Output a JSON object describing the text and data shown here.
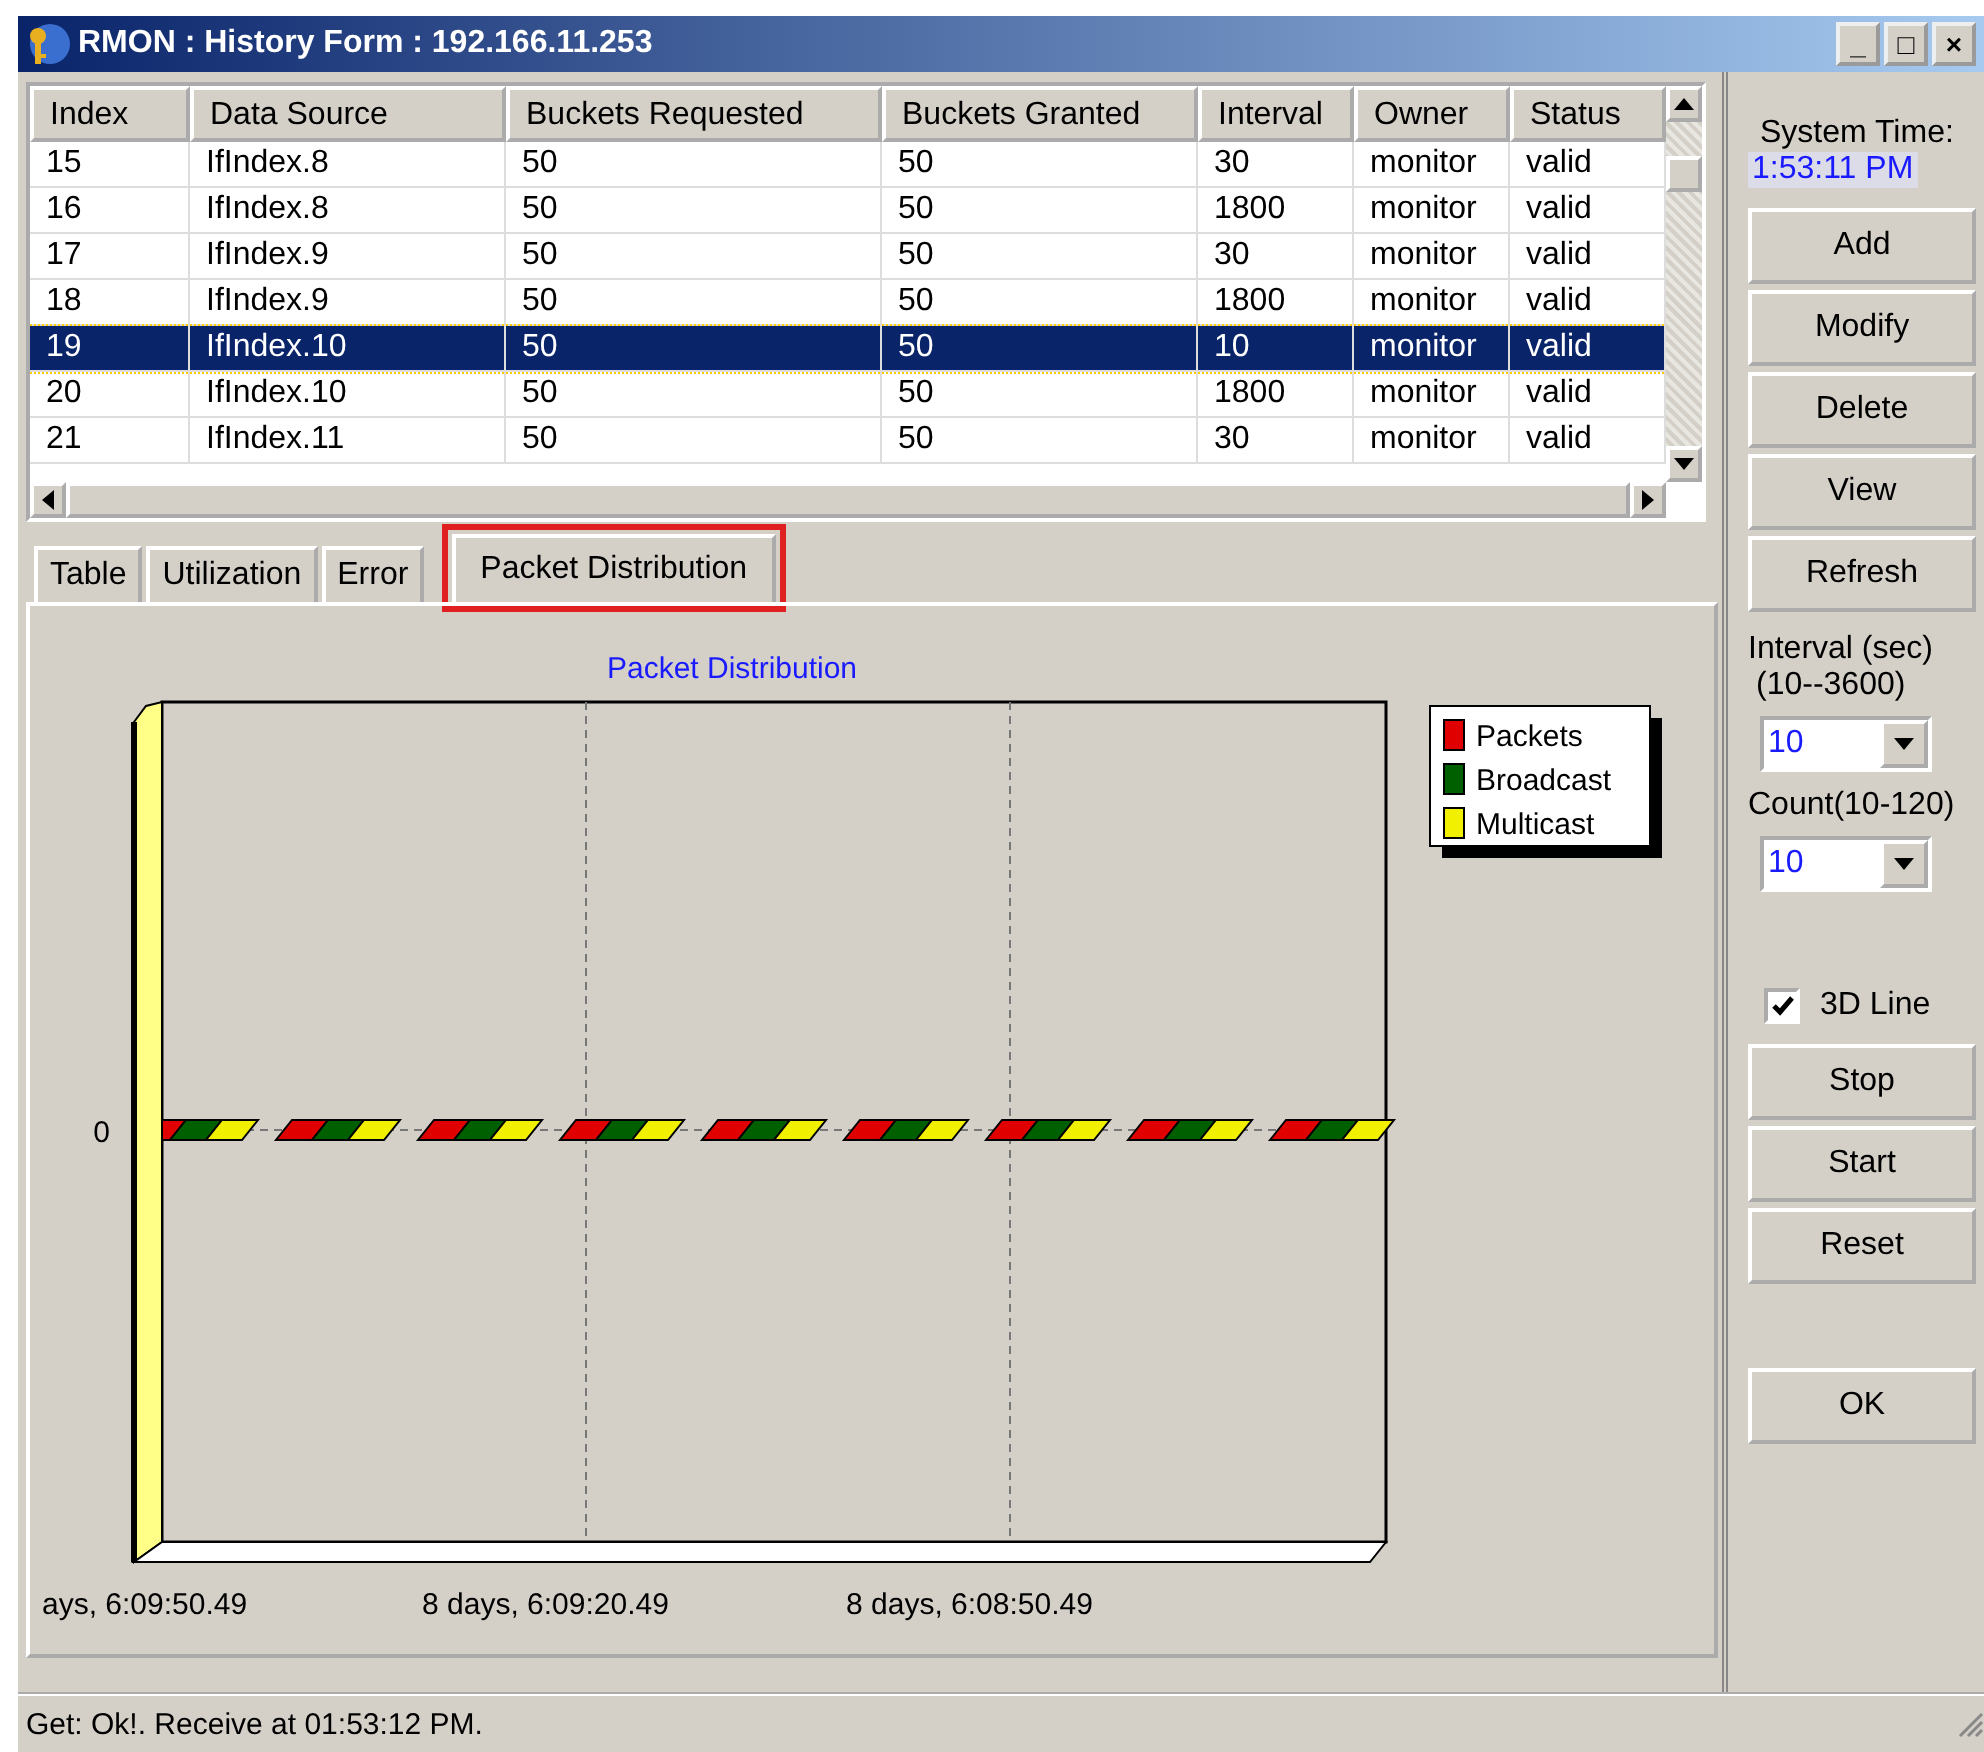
{
  "window": {
    "title": "RMON : History  Form : 192.166.11.253",
    "controls": [
      "_",
      "□",
      "×"
    ]
  },
  "table": {
    "columns": [
      "Index",
      "Data Source",
      "Buckets Requested",
      "Buckets Granted",
      "Interval",
      "Owner",
      "Status"
    ],
    "rows": [
      {
        "cells": [
          "15",
          "IfIndex.8",
          "50",
          "50",
          "30",
          "monitor",
          "valid"
        ],
        "selected": false
      },
      {
        "cells": [
          "16",
          "IfIndex.8",
          "50",
          "50",
          "1800",
          "monitor",
          "valid"
        ],
        "selected": false
      },
      {
        "cells": [
          "17",
          "IfIndex.9",
          "50",
          "50",
          "30",
          "monitor",
          "valid"
        ],
        "selected": false
      },
      {
        "cells": [
          "18",
          "IfIndex.9",
          "50",
          "50",
          "1800",
          "monitor",
          "valid"
        ],
        "selected": false
      },
      {
        "cells": [
          "19",
          "IfIndex.10",
          "50",
          "50",
          "10",
          "monitor",
          "valid"
        ],
        "selected": true
      },
      {
        "cells": [
          "20",
          "IfIndex.10",
          "50",
          "50",
          "1800",
          "monitor",
          "valid"
        ],
        "selected": false
      },
      {
        "cells": [
          "21",
          "IfIndex.11",
          "50",
          "50",
          "30",
          "monitor",
          "valid"
        ],
        "selected": false
      }
    ]
  },
  "tabs": [
    {
      "label": "Table",
      "selected": false
    },
    {
      "label": "Utilization",
      "selected": false
    },
    {
      "label": "Error",
      "selected": false
    },
    {
      "label": "Packet Distribution",
      "selected": true,
      "highlighted": true
    }
  ],
  "chart": {
    "title": "Packet Distribution",
    "y_tick": "0",
    "x_ticks": [
      "ays, 6:09:50.49",
      "8 days, 6:09:20.49",
      "8 days, 6:08:50.49"
    ],
    "legend": [
      {
        "label": "Packets",
        "color": "#e00000"
      },
      {
        "label": "Broadcast",
        "color": "#006000"
      },
      {
        "label": "Multicast",
        "color": "#f0f000"
      }
    ]
  },
  "side": {
    "system_time_label": "System Time:",
    "system_time": "1:53:11 PM",
    "top_buttons": [
      "Add",
      "Modify",
      "Delete",
      "View",
      "Refresh"
    ],
    "interval_label": "Interval (sec)",
    "interval_range": "(10--3600)",
    "interval_value": "10",
    "count_label": "Count(10-120)",
    "count_value": "10",
    "line3d": {
      "label": "3D Line",
      "checked": true
    },
    "run_buttons": [
      "Stop",
      "Start",
      "Reset"
    ],
    "ok": "OK"
  },
  "status_bar": "Get: Ok!. Receive at 01:53:12 PM."
}
